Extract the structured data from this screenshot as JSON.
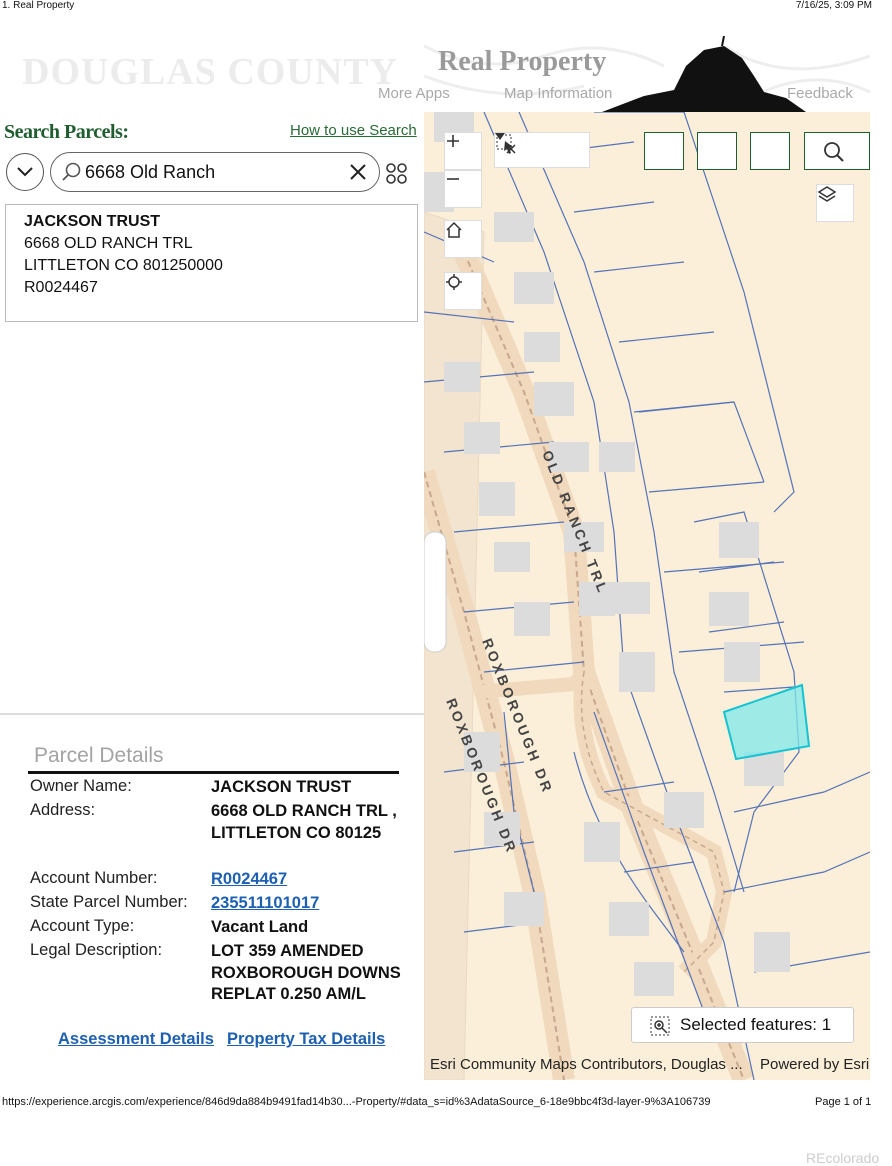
{
  "print_header": {
    "left": "1. Real Property",
    "right": "7/16/25, 3:09 PM"
  },
  "app": {
    "logo_text": "DOUGLAS COUNTY",
    "title": "Real Property",
    "nav": [
      "More Apps",
      "Map Information",
      "Feedback"
    ]
  },
  "search": {
    "label": "Search Parcels:",
    "help_link": "How to use Search",
    "value": "6668 Old Ranch"
  },
  "result": {
    "owner": "JACKSON TRUST",
    "street": "6668 OLD RANCH TRL",
    "city": "LITTLETON  CO 801250000",
    "account": "R0024467"
  },
  "parcel_details": {
    "title": "Parcel Details",
    "owner_label": "Owner Name:",
    "owner_value": "JACKSON TRUST",
    "address_label": "Address:",
    "address_value": "6668 OLD RANCH TRL , LITTLETON CO 80125",
    "account_label": "Account Number:",
    "account_value": "R0024467",
    "state_parcel_label": "State Parcel Number:",
    "state_parcel_value": "235511101017",
    "account_type_label": "Account Type:",
    "account_type_value": "Vacant Land",
    "legal_label": "Legal Description:",
    "legal_value": "LOT 359 AMENDED ROXBOROUGH DOWNS REPLAT 0.250 AM/L",
    "assessment_link": "Assessment Details",
    "tax_link": "Property Tax Details"
  },
  "map": {
    "road_labels": [
      "OLD RANCH TRL",
      "ROXBOROUGH DR",
      "ROXBOROUGH DR"
    ],
    "selected_features": "Selected features: 1",
    "attribution": "Esri Community Maps Contributors, Douglas ...",
    "powered_by": "Powered by Esri",
    "highlight_color": "#7fe8ea"
  },
  "footer": {
    "url": "https://experience.arcgis.com/experience/846d9da884b9491fad14b30...-Property/#data_s=id%3AdataSource_6-18e9bbc4f3d-layer-9%3A106739",
    "page": "Page 1 of 1",
    "watermark": "REcolorado"
  }
}
